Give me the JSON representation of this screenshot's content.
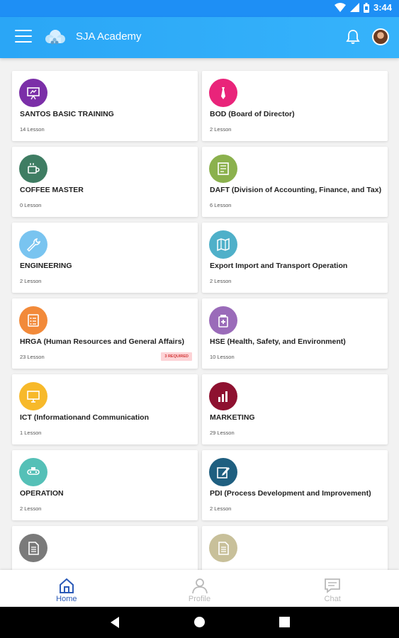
{
  "status_bar": {
    "time": "3:44"
  },
  "app_bar": {
    "title": "SJA Academy"
  },
  "courses": [
    {
      "title": "SANTOS BASIC TRAINING",
      "lessons": "14 Lesson",
      "color": "#7b2fa8",
      "icon": "presentation-icon"
    },
    {
      "title": "BOD (Board of Director)",
      "lessons": "2 Lesson",
      "color": "#e9247a",
      "icon": "tie-icon"
    },
    {
      "title": "COFFEE MASTER",
      "lessons": "0 Lesson",
      "color": "#3f7d63",
      "icon": "coffee-cup-icon"
    },
    {
      "title": "DAFT (Division of Accounting, Finance, and Tax)",
      "lessons": "6 Lesson",
      "color": "#8bb14d",
      "icon": "ledger-icon"
    },
    {
      "title": "ENGINEERING",
      "lessons": "2 Lesson",
      "color": "#79c4f0",
      "icon": "wrench-icon"
    },
    {
      "title": "Export Import and Transport Operation",
      "lessons": "2 Lesson",
      "color": "#4fb0c9",
      "icon": "map-icon"
    },
    {
      "title": "HRGA (Human Resources and General Affairs)",
      "lessons": "23 Lesson",
      "color": "#f28a3a",
      "icon": "checklist-icon",
      "badge": "3 REQUIRED"
    },
    {
      "title": "HSE (Health, Safety, and Environment)",
      "lessons": "10 Lesson",
      "color": "#9a6bb9",
      "icon": "medicine-icon"
    },
    {
      "title": "ICT (Informationand Communication",
      "lessons": "1 Lesson",
      "color": "#f7b92a",
      "icon": "monitor-icon"
    },
    {
      "title": "MARKETING",
      "lessons": "29 Lesson",
      "color": "#8e1130",
      "icon": "bar-chart-icon"
    },
    {
      "title": "OPERATION",
      "lessons": "2 Lesson",
      "color": "#55c0b7",
      "icon": "conveyor-icon"
    },
    {
      "title": "PDI (Process Development and Improvement)",
      "lessons": "2 Lesson",
      "color": "#1f5f80",
      "icon": "edit-icon"
    },
    {
      "title": "",
      "lessons": "",
      "color": "#7a7a7a",
      "icon": "document-icon"
    },
    {
      "title": "",
      "lessons": "",
      "color": "#c8c09a",
      "icon": "document-icon"
    }
  ],
  "bottom_nav": [
    {
      "label": "Home",
      "icon": "home-icon",
      "active": true
    },
    {
      "label": "Profile",
      "icon": "person-icon",
      "active": false
    },
    {
      "label": "Chat",
      "icon": "chat-icon",
      "active": false
    }
  ]
}
